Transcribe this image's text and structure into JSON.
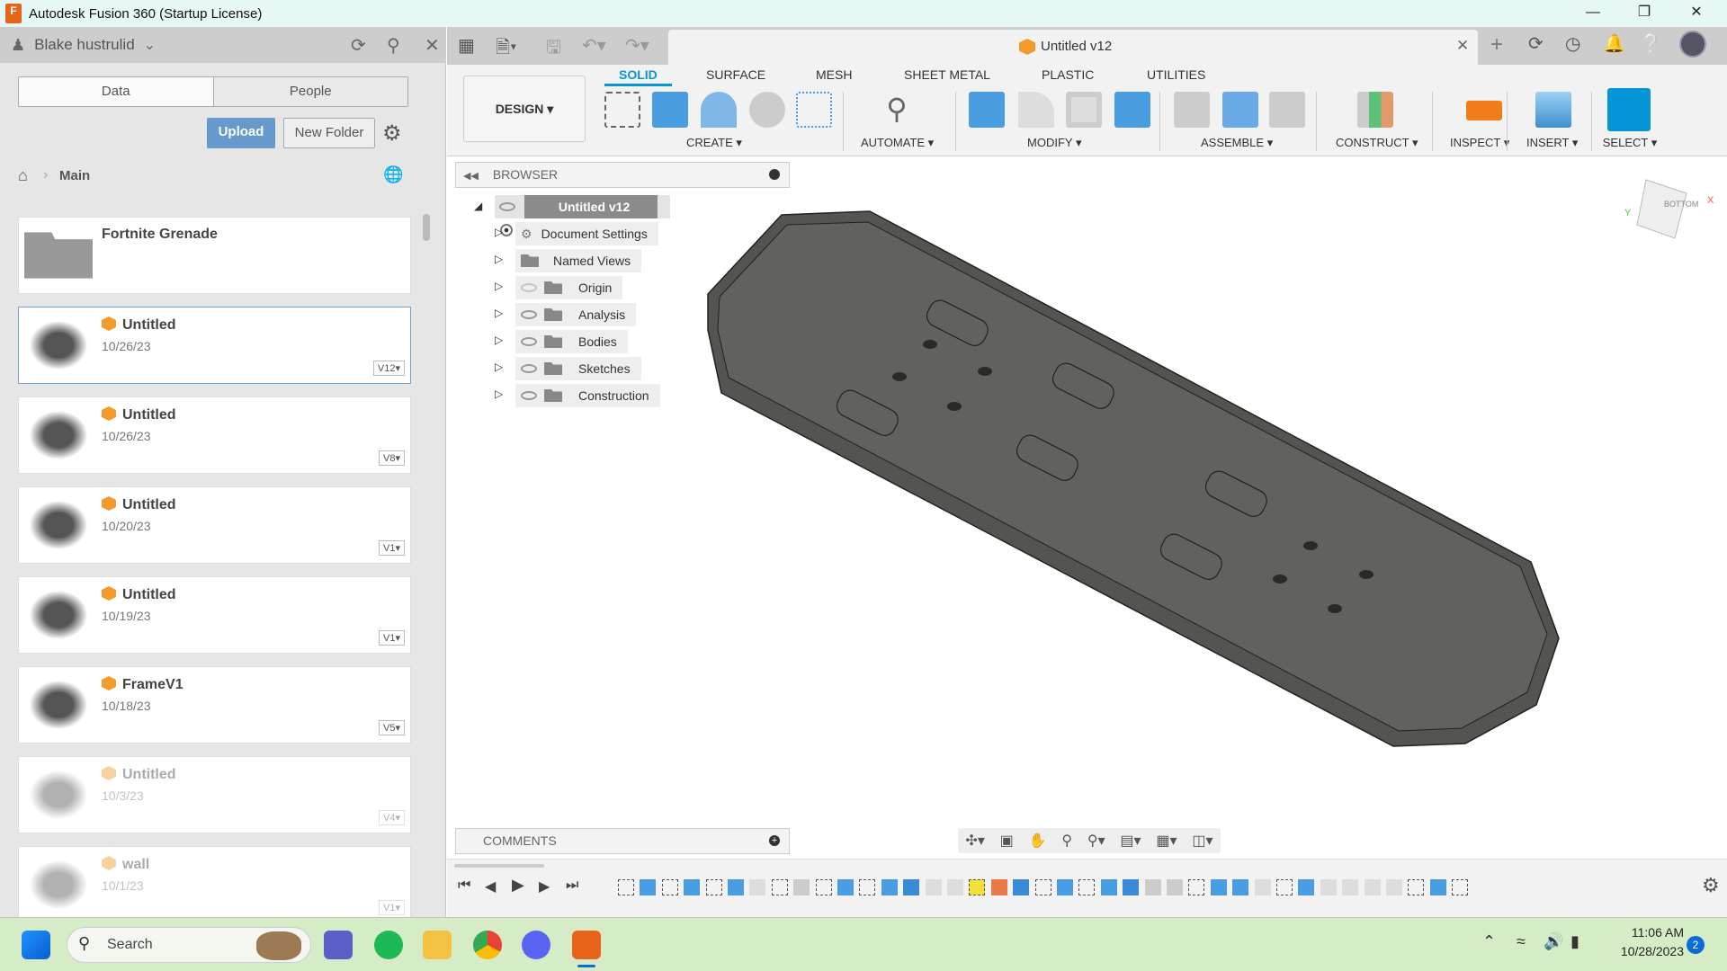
{
  "window": {
    "title": "Autodesk Fusion 360 (Startup License)",
    "app_logo": "F"
  },
  "data_panel": {
    "user": "Blake hustrulid",
    "tabs": [
      "Data",
      "People"
    ],
    "upload_label": "Upload",
    "new_folder_label": "New Folder",
    "breadcrumb": "Main",
    "items": [
      {
        "name": "Fortnite Grenade",
        "date": "",
        "version": "",
        "type": "folder"
      },
      {
        "name": "Untitled",
        "date": "10/26/23",
        "version": "V12",
        "type": "design",
        "selected": true
      },
      {
        "name": "Untitled",
        "date": "10/26/23",
        "version": "V8",
        "type": "design"
      },
      {
        "name": "Untitled",
        "date": "10/20/23",
        "version": "V1",
        "type": "design"
      },
      {
        "name": "Untitled",
        "date": "10/19/23",
        "version": "V1",
        "type": "design"
      },
      {
        "name": "FrameV1",
        "date": "10/18/23",
        "version": "V5",
        "type": "design"
      },
      {
        "name": "Untitled",
        "date": "10/3/23",
        "version": "V4",
        "type": "design",
        "dimmed": true
      },
      {
        "name": "wall",
        "date": "10/1/23",
        "version": "V1",
        "type": "design",
        "dimmed": true
      }
    ]
  },
  "document": {
    "tab_title": "Untitled v12"
  },
  "workspace": {
    "mode": "DESIGN"
  },
  "ribbon": {
    "tabs": [
      "SOLID",
      "SURFACE",
      "MESH",
      "SHEET METAL",
      "PLASTIC",
      "UTILITIES"
    ],
    "active_tab": "SOLID",
    "groups": [
      "CREATE",
      "AUTOMATE",
      "MODIFY",
      "ASSEMBLE",
      "CONSTRUCT",
      "INSPECT",
      "INSERT",
      "SELECT"
    ],
    "accent": "#0696d7"
  },
  "browser": {
    "title": "BROWSER",
    "root": "Untitled v12",
    "nodes": [
      "Document Settings",
      "Named Views",
      "Origin",
      "Analysis",
      "Bodies",
      "Sketches",
      "Construction"
    ]
  },
  "comments": {
    "title": "COMMENTS"
  },
  "timeline": {
    "features": [
      "sketch",
      "extrude",
      "sketch",
      "extrude",
      "sketch",
      "extrude",
      "fillet",
      "sketch",
      "shell",
      "sketch",
      "extrude",
      "sketch",
      "extrude",
      "combine",
      "chamfer",
      "fillet",
      "sketch-active",
      "appearance",
      "move",
      "sketch",
      "extrude",
      "sketch",
      "extrude",
      "combine",
      "shell",
      "shell",
      "sketch",
      "extrude",
      "extrude",
      "chamfer",
      "sketch",
      "extrude",
      "fillet",
      "fillet",
      "fillet",
      "fillet",
      "sketch",
      "extrude",
      "sketch"
    ]
  },
  "taskbar": {
    "search_placeholder": "Search",
    "time": "11:06 AM",
    "date": "10/28/2023",
    "notifications": "2"
  }
}
